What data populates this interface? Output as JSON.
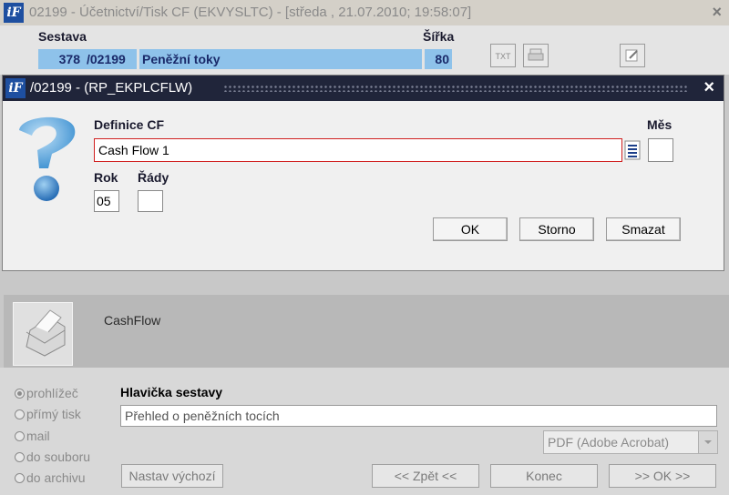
{
  "window": {
    "title": "02199 - Účetnictví/Tisk CF (EKVYSLTC) - [středa , 21.07.2010; 19:58:07]",
    "close": "×",
    "logo": "iF"
  },
  "header": {
    "sestava_label": "Sestava",
    "sestava_number": "378",
    "sestava_code": "/02199",
    "sestava_name": "Peněžní toky",
    "sirka_label": "Šířka",
    "sirka_value": "80",
    "toolbar": {
      "txt_label": "TXT"
    }
  },
  "dialog": {
    "title": "/02199 - (RP_EKPLCFLW)",
    "close": "×",
    "definice_label": "Definice CF",
    "definice_value": "Cash Flow 1",
    "mes_label": "Měs",
    "rok_label": "Rok",
    "rok_value": "05",
    "rady_label": "Řády",
    "ok_label": "OK",
    "storno_label": "Storno",
    "smazat_label": "Smazat"
  },
  "report": {
    "name": "CashFlow"
  },
  "output": {
    "options": [
      {
        "label": "prohlížeč",
        "selected": true
      },
      {
        "label": "přímý tisk",
        "selected": false
      },
      {
        "label": "mail",
        "selected": false
      },
      {
        "label": "do souboru",
        "selected": false
      },
      {
        "label": "do archivu",
        "selected": false
      }
    ],
    "hlavicka_label": "Hlavička sestavy",
    "hlavicka_value": "Přehled o peněžních tocích",
    "format_selected": "PDF (Adobe Acrobat)",
    "nastav_label": "Nastav výchozí",
    "zpet_label": "<< Zpět <<",
    "konec_label": "Konec",
    "ok_label": ">> OK >>"
  }
}
